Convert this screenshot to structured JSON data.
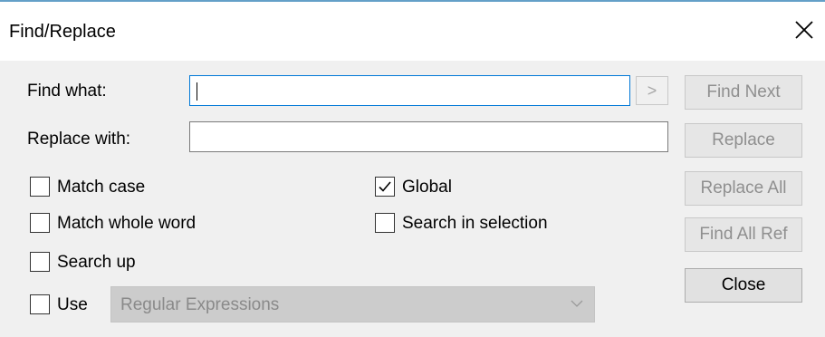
{
  "window": {
    "title": "Find/Replace"
  },
  "fields": {
    "find_label": "Find what:",
    "find_value": "",
    "replace_label": "Replace with:",
    "replace_value": "",
    "arrow_label": ">"
  },
  "buttons": {
    "find_next": "Find Next",
    "replace": "Replace",
    "replace_all": "Replace All",
    "find_all_ref": "Find All Ref",
    "close": "Close"
  },
  "options": {
    "match_case": {
      "label": "Match case",
      "checked": false
    },
    "match_whole_word": {
      "label": "Match whole word",
      "checked": false
    },
    "search_up": {
      "label": "Search up",
      "checked": false
    },
    "global": {
      "label": "Global",
      "checked": true
    },
    "search_in_selection": {
      "label": "Search in selection",
      "checked": false
    },
    "use": {
      "label": "Use",
      "checked": false
    }
  },
  "syntax_select": {
    "selected": "Regular Expressions"
  },
  "icons": {
    "close": "close-icon",
    "checkmark": "checkmark-icon",
    "dropdown": "chevron-down-icon"
  }
}
